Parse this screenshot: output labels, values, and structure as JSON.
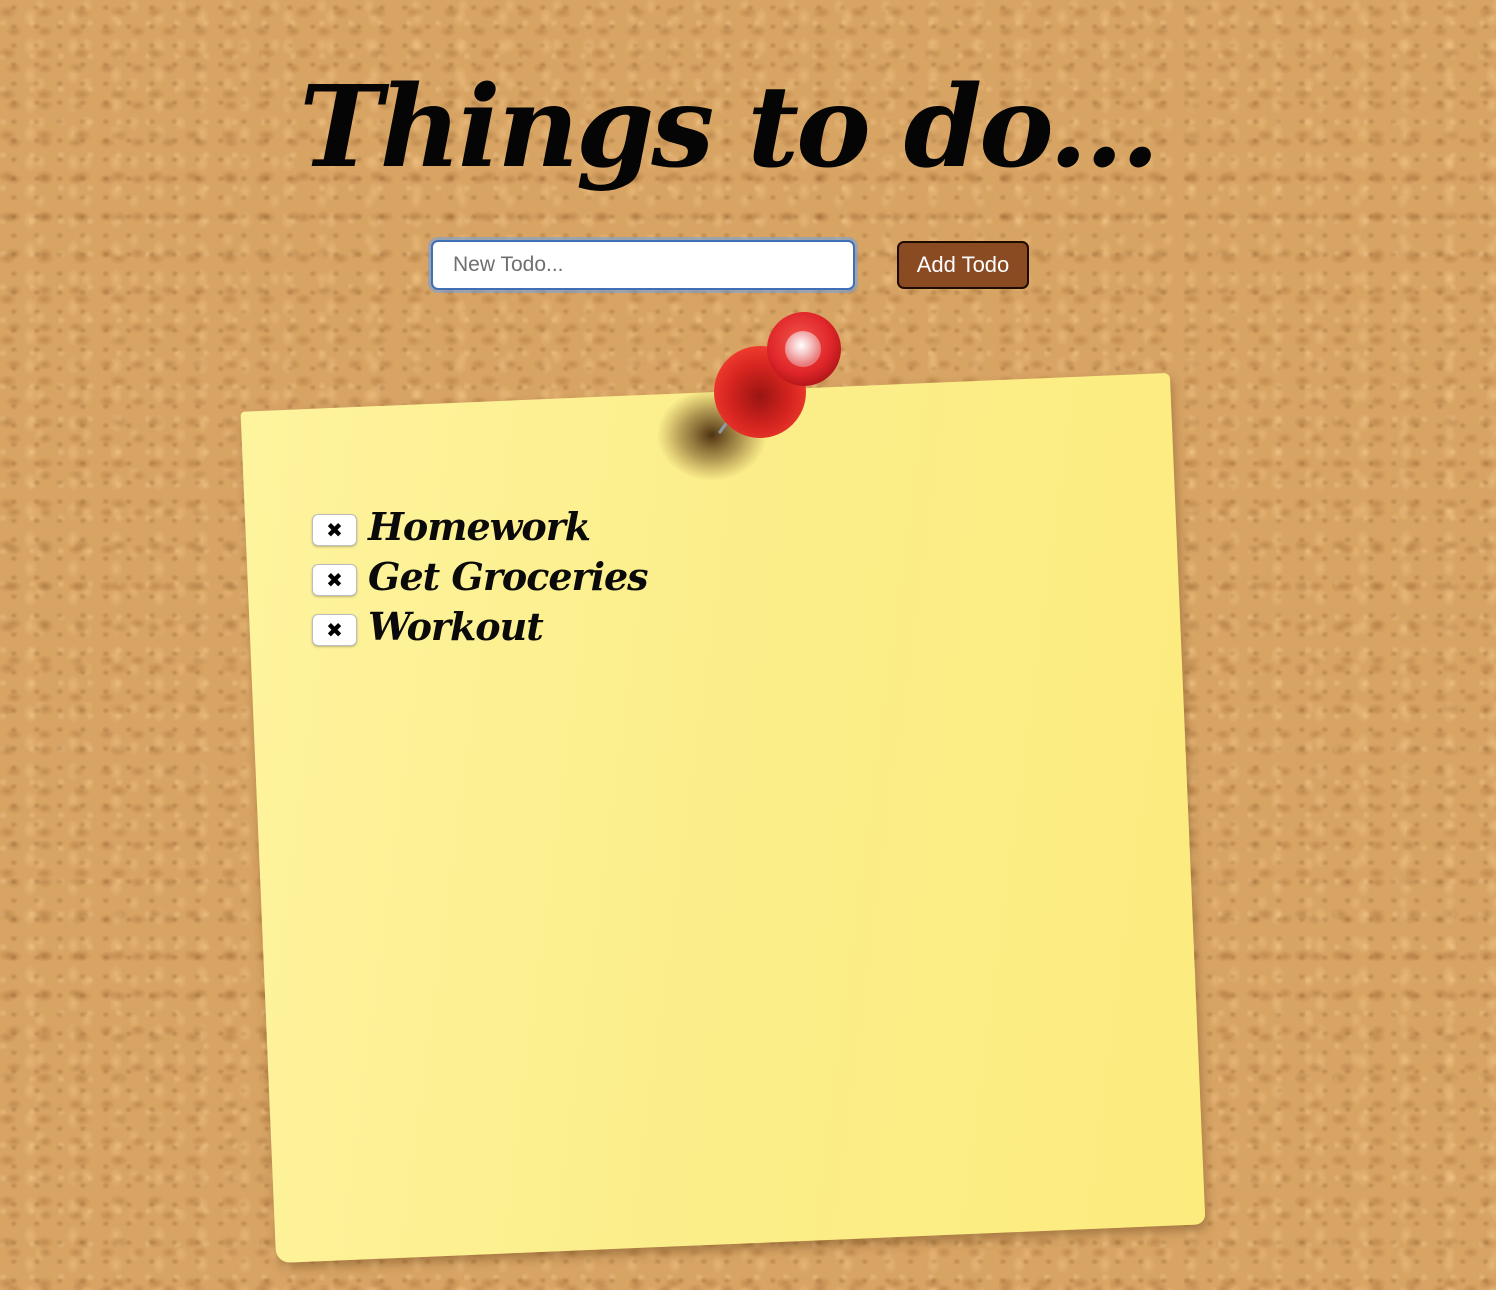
{
  "header": {
    "title": "Things to do..."
  },
  "form": {
    "input_placeholder": "New Todo...",
    "input_value": "",
    "add_label": "Add Todo"
  },
  "todos": [
    {
      "label": "Homework",
      "delete_glyph": "✖"
    },
    {
      "label": "Get Groceries",
      "delete_glyph": "✖"
    },
    {
      "label": "Workout",
      "delete_glyph": "✖"
    }
  ],
  "icons": {
    "delete": "close-icon",
    "pin": "pushpin-icon"
  },
  "colors": {
    "corkboard": "#d8a464",
    "note": "#fbee8b",
    "add_button": "#8a4a22",
    "pin": "#e0262a",
    "input_focus": "#3f6fb5"
  }
}
